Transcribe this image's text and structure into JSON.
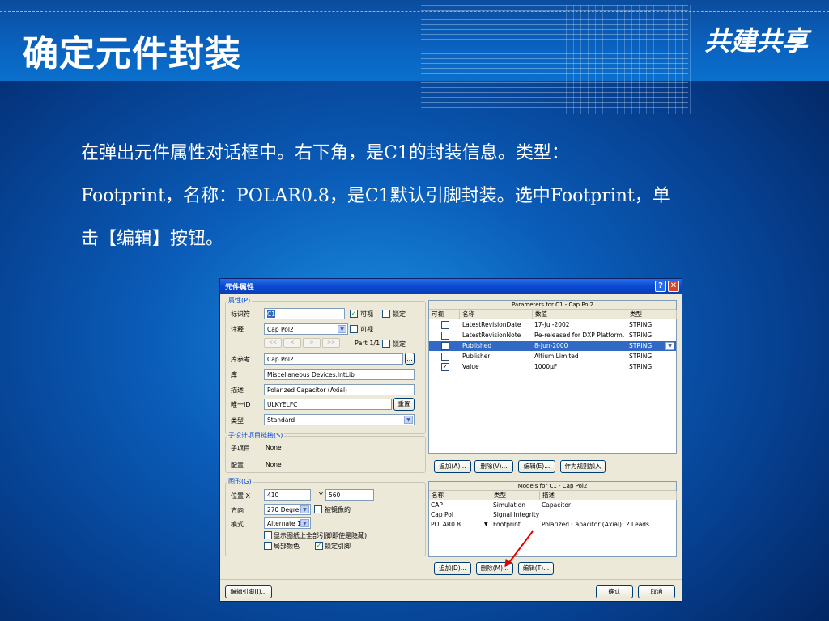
{
  "slide": {
    "title": "确定元件封装",
    "brand": "共建共享",
    "paragraph_line1": "在弹出元件属性对话框中。右下角，是C1的封装信息。类型：",
    "paragraph_line2": "Footprint，名称：POLAR0.8，是C1默认引脚封装。选中Footprint，单",
    "paragraph_line3": "击【编辑】按钮。"
  },
  "dialog": {
    "title": "元件属性",
    "help_glyph": "?",
    "close_glyph": "✕",
    "properties": {
      "group_label": "属性(P)",
      "designator_label": "标识符",
      "designator_value": "C1",
      "visible_label": "可视",
      "lock_label": "锁定",
      "comment_label": "注释",
      "comment_value": "Cap Pol2",
      "comment_visible_label": "可视",
      "nav_first": "<<",
      "nav_prev": "<",
      "nav_next": ">",
      "nav_last": ">>",
      "part_text": "Part 1/1",
      "part_lock_label": "锁定",
      "libref_label": "库参考",
      "libref_value": "Cap Pol2",
      "browse_label": "...",
      "library_label": "库",
      "library_value": "Miscellaneous Devices.IntLib",
      "description_label": "描述",
      "description_value": "Polarized Capacitor (Axial)",
      "uid_label": "唯一ID",
      "uid_value": "ULKYELFC",
      "reset_label": "重置",
      "type_label": "类型",
      "type_value": "Standard"
    },
    "subdesign": {
      "group_label": "子设计项目链接(S)",
      "subproject_label": "子项目",
      "subproject_value": "None",
      "config_label": "配置",
      "config_value": "None"
    },
    "graphical": {
      "group_label": "图形(G)",
      "location_label": "位置 X",
      "x_value": "410",
      "y_label": "Y",
      "y_value": "560",
      "orientation_label": "方向",
      "orientation_value": "270 Degrees",
      "mirrored_label": "被镜像的",
      "mode_label": "模式",
      "mode_value": "Alternate 1",
      "show_hidden_pins_label": "显示图纸上全部引脚即使是隐藏)",
      "local_colors_label": "局部颜色",
      "lock_pins_label": "锁定引脚"
    },
    "parameters": {
      "header": "Parameters for C1 - Cap Pol2",
      "columns": [
        "可视",
        "名称",
        "数值",
        "类型"
      ],
      "rows": [
        {
          "visible": false,
          "name": "LatestRevisionDate",
          "value": "17-Jul-2002",
          "type": "STRING"
        },
        {
          "visible": false,
          "name": "LatestRevisionNote",
          "value": "Re-released for DXP Platform.",
          "type": "STRING"
        },
        {
          "visible": false,
          "name": "Published",
          "value": "8-Jun-2000",
          "type": "STRING",
          "selected": true
        },
        {
          "visible": false,
          "name": "Publisher",
          "value": "Altium Limited",
          "type": "STRING"
        },
        {
          "visible": true,
          "name": "Value",
          "value": "1000µF",
          "type": "STRING"
        }
      ],
      "add_btn": "追加(A)...",
      "remove_btn": "删除(V)...",
      "edit_btn": "编辑(E)...",
      "rule_btn": "作为规则加入"
    },
    "models": {
      "header": "Models for C1 - Cap Pol2",
      "columns": [
        "名称",
        "类型",
        "描述"
      ],
      "rows": [
        {
          "name": "CAP",
          "type": "Simulation",
          "description": "Capacitor"
        },
        {
          "name": "Cap Pol",
          "type": "Signal Integrity",
          "description": ""
        },
        {
          "name": "POLAR0.8",
          "type": "Footprint",
          "description": "Polarized Capacitor (Axial): 2 Leads"
        }
      ],
      "add_btn": "追加(D)...",
      "remove_btn": "删除(M)...",
      "edit_btn": "编辑(T)..."
    },
    "footer": {
      "edit_pins_btn": "编辑引脚(I)...",
      "ok_btn": "确认",
      "cancel_btn": "取消"
    }
  }
}
